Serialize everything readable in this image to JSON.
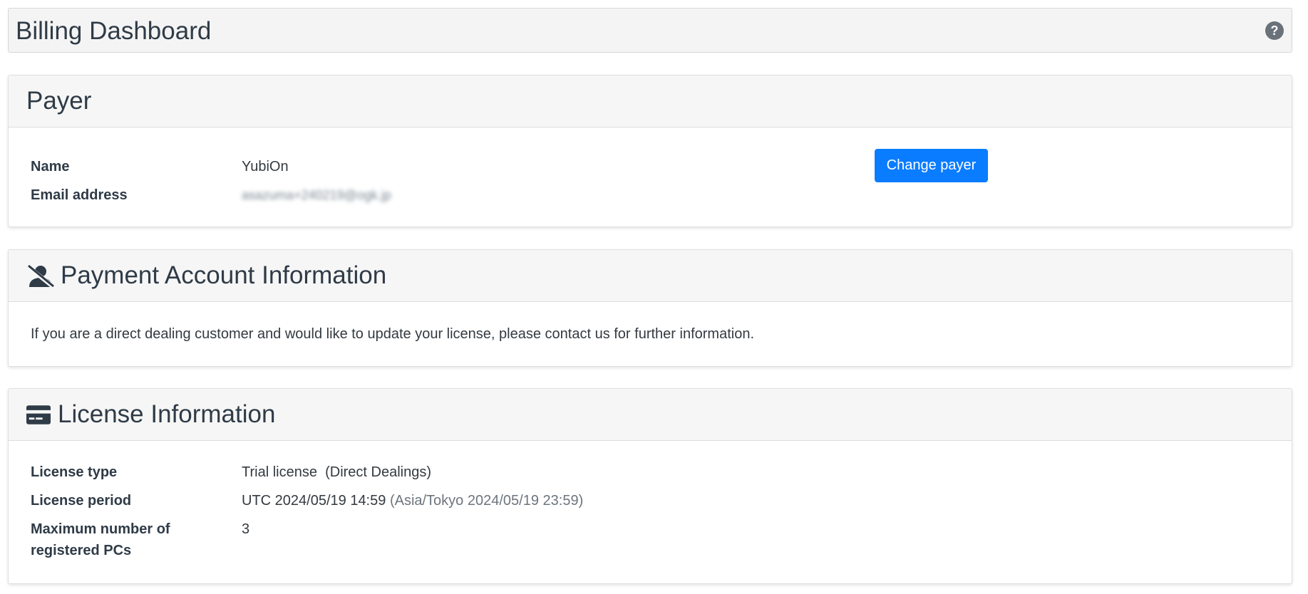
{
  "header": {
    "title": "Billing Dashboard",
    "help_icon": "question-circle-icon"
  },
  "payer": {
    "title": "Payer",
    "name_label": "Name",
    "name_value": "YubiOn",
    "email_label": "Email address",
    "email_value": "asazuma+240219@ogk.jp",
    "change_button": "Change payer"
  },
  "payment_account": {
    "icon": "user-slash-icon",
    "title": "Payment Account Information",
    "message": "If you are a direct dealing customer and would like to update your license, please contact us for further information."
  },
  "license": {
    "icon": "credit-card-icon",
    "title": "License Information",
    "type_label": "License type",
    "type_value": "Trial license",
    "type_note": "(Direct Dealings)",
    "period_label": "License period",
    "period_utc": "UTC 2024/05/19 14:59",
    "period_local": "(Asia/Tokyo 2024/05/19 23:59)",
    "max_pcs_label_line1": "Maximum number of",
    "max_pcs_label_line2": "registered PCs",
    "max_pcs_value": "3"
  },
  "colors": {
    "primary_button": "#0a7cff",
    "header_bg": "#f4f4f4",
    "text": "#2f3b47"
  }
}
